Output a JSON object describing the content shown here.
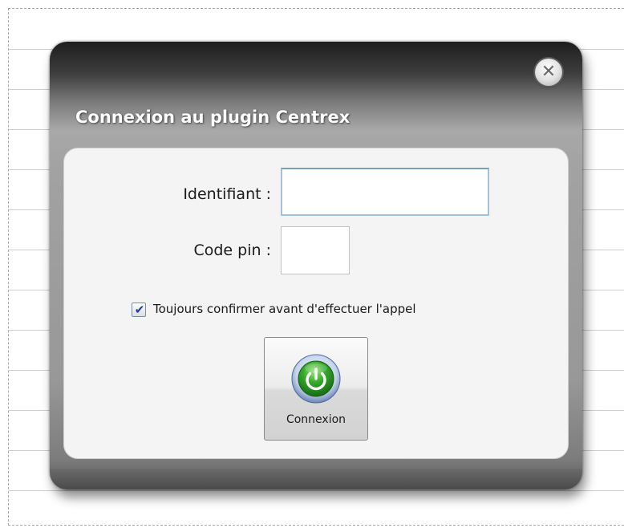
{
  "dialog": {
    "title": "Connexion au plugin Centrex",
    "close_button": {
      "icon": "close-icon",
      "glyph": "✕"
    }
  },
  "form": {
    "identifiant_label": "Identifiant :",
    "identifiant_value": "",
    "pin_label": "Code pin :",
    "pin_value": "",
    "confirm_checkbox": {
      "label": "Toujours confirmer avant d'effectuer l'appel",
      "checked": true,
      "check_glyph": "✔"
    },
    "connect_button": {
      "label": "Connexion",
      "icon": "power-icon"
    }
  },
  "colors": {
    "power_icon_green": "#2f9a2a",
    "checkmark_blue": "#1c3f9a",
    "ruled_line_blue": "#bfd0ea"
  }
}
